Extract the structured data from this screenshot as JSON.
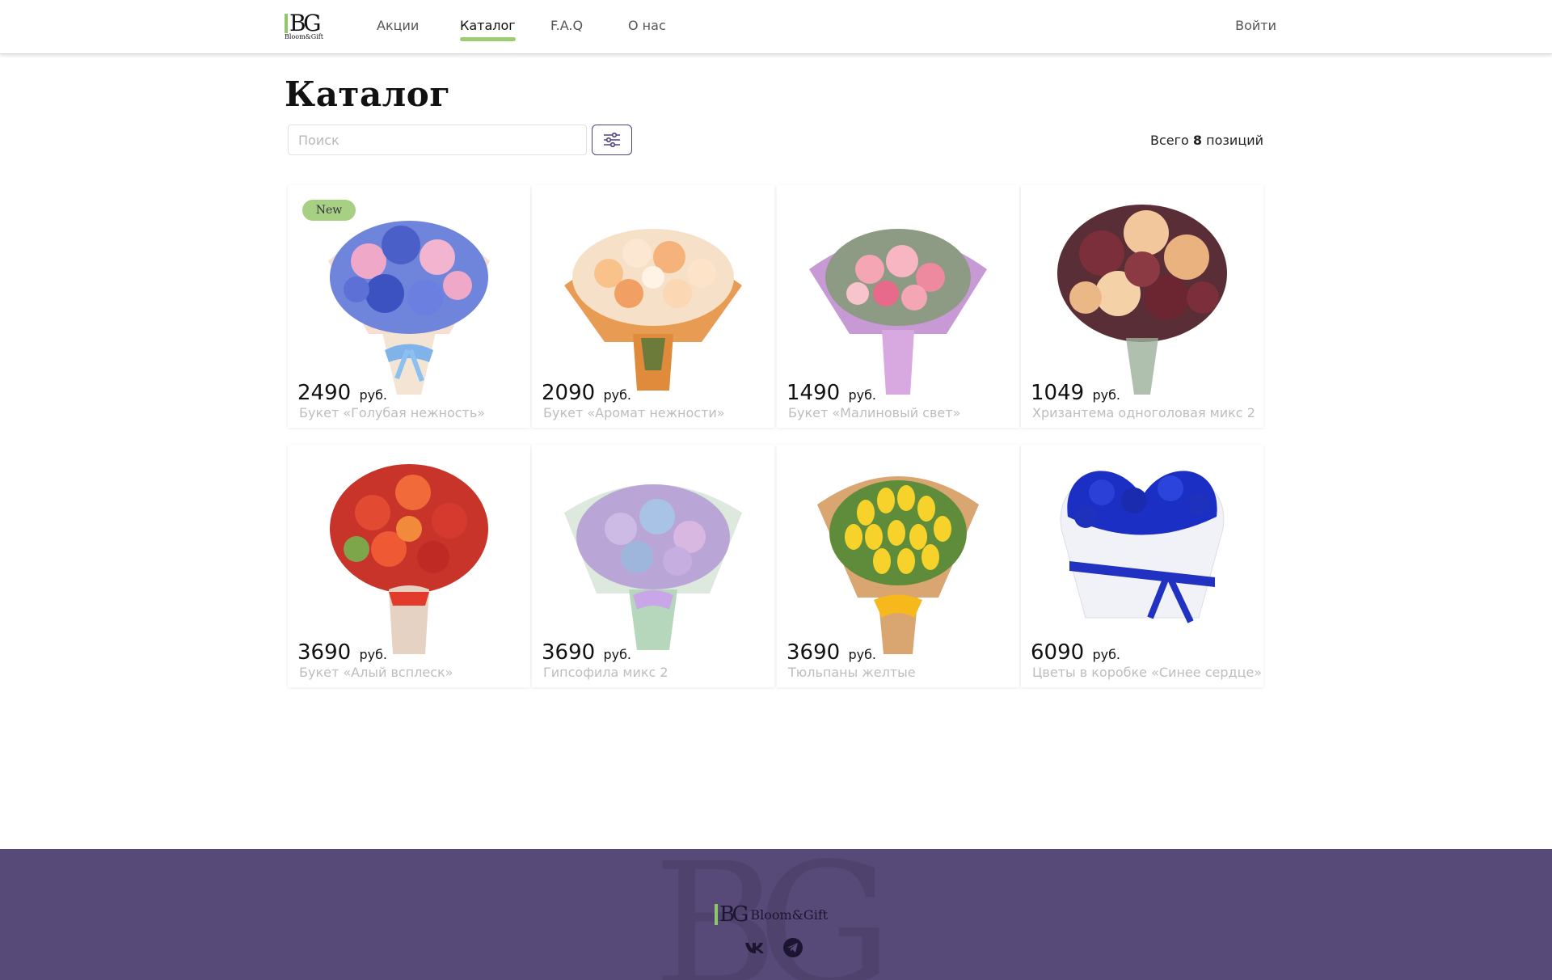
{
  "header": {
    "logo_mark": "BG",
    "logo_sub": "Bloom&Gift",
    "nav": [
      {
        "label": "Акции"
      },
      {
        "label": "Каталог"
      },
      {
        "label": "F.A.Q"
      },
      {
        "label": "О нас"
      }
    ],
    "login": "Войти"
  },
  "catalog": {
    "title": "Каталог",
    "search_placeholder": "Поиск",
    "total_prefix": "Всего",
    "total_count": "8",
    "total_suffix": "позиций",
    "currency": "руб.",
    "badge_new": "New",
    "items": [
      {
        "price": "2490",
        "name": "Букет «Голубая нежность»",
        "image": "blue-hyacinth-bouquet"
      },
      {
        "price": "2090",
        "name": "Букет «Аромат нежности»",
        "image": "peach-gerbera-bouquet"
      },
      {
        "price": "1490",
        "name": "Букет «Малиновый свет»",
        "image": "pink-roses-bouquet"
      },
      {
        "price": "1049",
        "name": "Хризантема одноголовая микс 2",
        "image": "chrysanthemum-mix-bouquet"
      },
      {
        "price": "3690",
        "name": "Букет «Алый всплеск»",
        "image": "red-alstroemeria-bouquet"
      },
      {
        "price": "3690",
        "name": "Гипсофила микс 2",
        "image": "gypsophila-mix-bouquet"
      },
      {
        "price": "3690",
        "name": "Тюльпаны желтые",
        "image": "yellow-tulips-bouquet"
      },
      {
        "price": "6090",
        "name": "Цветы в коробке «Синее сердце»",
        "image": "blue-heart-box"
      }
    ]
  },
  "footer": {
    "logo_mark": "BG",
    "brand": "Bloom&Gift",
    "social": [
      "vk-icon",
      "telegram-icon"
    ]
  },
  "colors": {
    "accent_green": "#9ccd74",
    "footer_bg": "#574a79",
    "filter_border": "#52407a"
  }
}
